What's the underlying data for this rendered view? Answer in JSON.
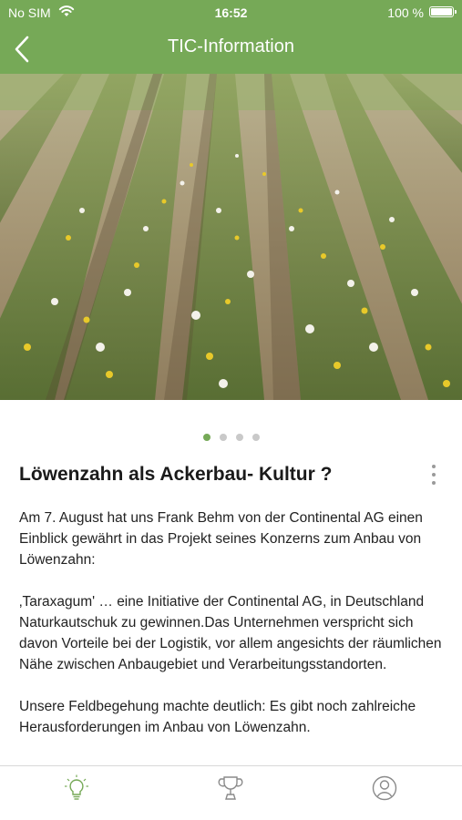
{
  "status_bar": {
    "carrier": "No SIM",
    "time": "16:52",
    "battery": "100 %"
  },
  "nav": {
    "title": "TIC-Information"
  },
  "colors": {
    "header_bg": "#76a957",
    "accent": "#76a957",
    "dot_inactive": "#c9c9c9"
  },
  "carousel": {
    "slide_count": 4,
    "active_slide": 1,
    "image": "dandelion-field-photo"
  },
  "article": {
    "title": "Löwenzahn als Ackerbau- Kultur ?",
    "paragraphs": [
      "Am 7. August hat uns Frank Behm von der Continental AG einen Einblick gewährt in das Projekt seines Konzerns zum Anbau von Löwenzahn:",
      "‚Taraxagum' … eine Initiative der Continental AG, in Deutschland Naturkautschuk  zu gewinnen.Das Unternehmen verspricht sich davon Vorteile bei der Logistik, vor allem angesichts der räumlichen Nähe zwischen Anbaugebiet und Verarbeitungsstandorten.",
      "Unsere Feldbegehung machte deutlich: Es gibt noch zahlreiche Herausforderungen im Anbau von Löwenzahn."
    ]
  },
  "tab_bar": {
    "items": [
      {
        "icon": "lightbulb-icon",
        "active": true
      },
      {
        "icon": "trophy-icon",
        "active": false
      },
      {
        "icon": "profile-icon",
        "active": false
      }
    ]
  }
}
